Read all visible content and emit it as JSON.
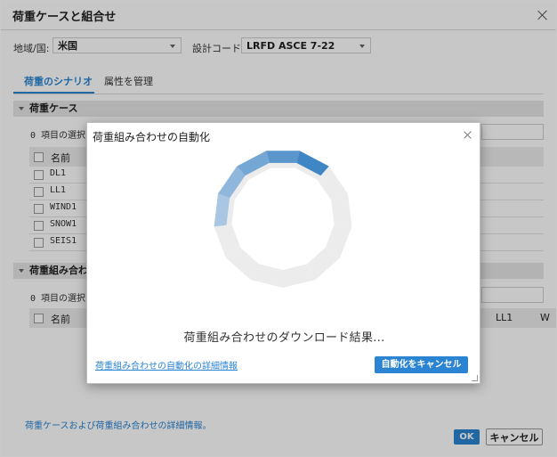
{
  "window": {
    "title": "荷重ケースと組合せ"
  },
  "filters": {
    "region_label": "地域/国:",
    "region_value": "米国",
    "code_label": "設計コード:",
    "code_value": "LRFD ASCE 7-22"
  },
  "tabs": [
    {
      "label": "荷重のシナリオ",
      "active": true
    },
    {
      "label": "属性を管理",
      "active": false
    }
  ],
  "load_cases": {
    "header": "荷重ケース",
    "selection": "0 項目の選択",
    "column_name": "名前",
    "rows": [
      "DL1",
      "LL1",
      "WIND1",
      "SNOW1",
      "SEIS1"
    ]
  },
  "combinations": {
    "header": "荷重組み合わせ",
    "selection": "0 項目の選択",
    "column_name": "名前",
    "column_ll1": "LL1",
    "column_w": "W"
  },
  "footer": {
    "details_link": "荷重ケースおよび荷重組み合わせの詳細情報。",
    "ok_label": "OK",
    "cancel_label": "キャンセル"
  },
  "modal": {
    "title": "荷重組み合わせの自動化",
    "message": "荷重組み合わせのダウンロード結果...",
    "details_link": "荷重組み合わせの自動化の詳細情報",
    "cancel_button": "自動化をキャンセル"
  },
  "colors": {
    "accent": "#2a84d2",
    "spinner_light": "#a9c7e3",
    "spinner_dark": "#3f86c4",
    "spinner_track": "#ececec"
  },
  "icons": {
    "close": "close-icon",
    "dropdown": "chevron-down-icon",
    "collapse": "triangle-down-icon",
    "spinner": "loading-spinner-icon",
    "resize": "resize-grip-icon"
  }
}
